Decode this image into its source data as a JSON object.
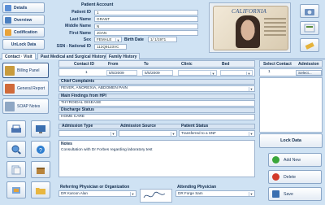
{
  "left_actions": [
    {
      "label": "Details",
      "icon": "details-icon"
    },
    {
      "label": "Overview",
      "icon": "overview-icon"
    },
    {
      "label": "Codification",
      "icon": "codification-icon"
    },
    {
      "label": "UnLock Data",
      "icon": ""
    }
  ],
  "patient": {
    "header": "Patient Account",
    "fields": [
      {
        "label": "Patient ID",
        "value": "1"
      },
      {
        "label": "Last Name",
        "value": "GRANT"
      },
      {
        "label": "Middle Name",
        "value": "N"
      },
      {
        "label": "First Name",
        "value": "JOAN"
      }
    ],
    "sex_label": "Sex",
    "sex_value": "FEMALE",
    "dob_label": "Birth Date",
    "dob_value": "1/ 1/1971",
    "ssn_label": "SSN - National ID",
    "ssn_value": "112Q9123VC"
  },
  "id_card": {
    "state": "CALIFORNIA"
  },
  "tabs": [
    "Contact · Visit",
    "Past Medical and Surgical History",
    "Family History"
  ],
  "nav": [
    "Billing Panel",
    "General Report",
    "SOAP Notes"
  ],
  "grid": {
    "headers": [
      "Contact ID",
      "From",
      "To",
      "Clinic",
      "Bed"
    ],
    "row": {
      "contact_id": "1",
      "from": "5/5/2009",
      "to": "5/5/2009",
      "clinic": "",
      "bed": ""
    }
  },
  "form": {
    "chief_complaints_label": "Chief Complaints",
    "chief_complaints_value": "FEVER, ANOREXIA, ABDOMEN PAIN",
    "main_findings_label": "Main Findings from HPI",
    "main_findings_value": "THYROIDAL DISEASE",
    "discharge_label": "Discharge Status",
    "discharge_value": "HOME CARE",
    "admission_type_label": "Admission Type",
    "admission_source_label": "Admission Source",
    "patient_status_label": "Patient Status",
    "patient_status_value": "Transferred to a SNF",
    "notes_label": "Notes",
    "notes_value": "Consultation with Dr Forbes regarding laboratory test",
    "referring_label": "Referring Physician or Organization",
    "referring_value": "DR Karoon Alan",
    "attending_label": "Attending Physician",
    "attending_value": "DR Forge Sam"
  },
  "right": {
    "select_contact": "Select Contact",
    "admission": "Admission",
    "row_id": "1",
    "select_button": "Select..."
  },
  "actions": {
    "lock": "Lock Data",
    "add": "Add New",
    "delete": "Delete",
    "save": "Save"
  },
  "colors": {
    "background": "#cfe2f3",
    "add_icon": "#3aa63a",
    "delete_icon": "#d23a2a",
    "accent": "#1d3f6e"
  }
}
